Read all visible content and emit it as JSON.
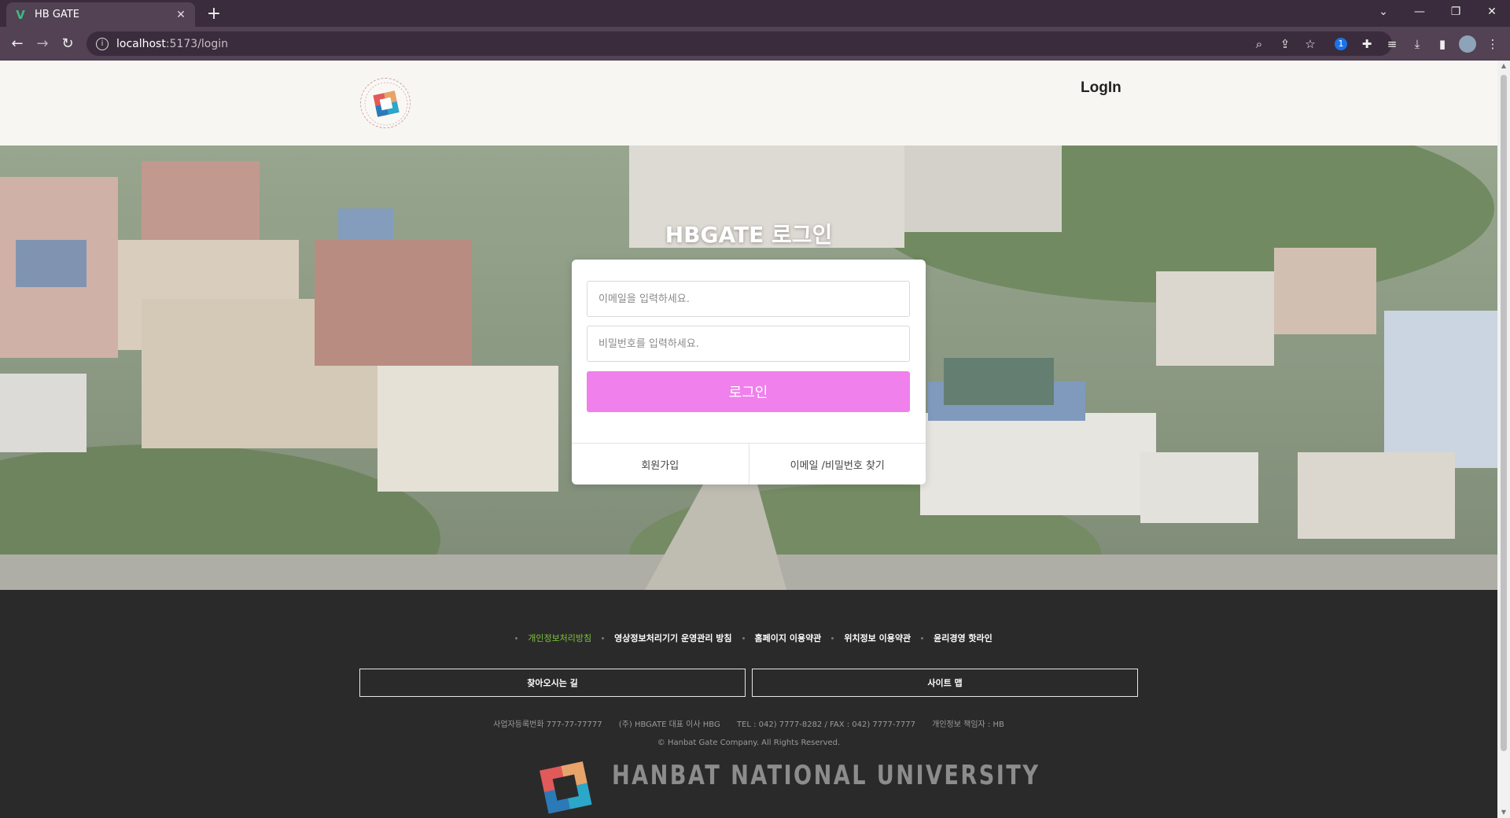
{
  "browser": {
    "tab_title": "HB GATE",
    "tab_favicon": "vue-logo-icon",
    "url_host": "localhost",
    "url_path": ":5173/login"
  },
  "header": {
    "logo_icon": "hbgate-circular-logo-icon",
    "login_link": "LogIn"
  },
  "login": {
    "title": "HBGATE 로그인",
    "email_placeholder": "이메일을 입력하세요.",
    "password_placeholder": "비밀번호를 입력하세요.",
    "submit_label": "로그인",
    "signup_label": "회원가입",
    "find_label": "이메일 /비밀번호 찾기"
  },
  "footer": {
    "links": [
      "개인정보처리방침",
      "영상정보처리기기 운영관리 방침",
      "홈페이지 이용약관",
      "위치정보 이용약관",
      "윤리경영 핫라인"
    ],
    "directions_button": "찾아오시는 길",
    "sitemap_button": "사이트 맵",
    "business_no": "사업자등록번화 777-77-77777",
    "company": "(주) HBGATE 대표 이사 HBG",
    "contact": "TEL : 042) 7777-8282 / FAX : 042) 7777-7777",
    "privacy_officer": "개인정보 책임자 : HB",
    "copyright": "© Hanbat Gate Company. All Rights Reserved.",
    "university_name": "HANBAT NATIONAL UNIVERSITY"
  },
  "colors": {
    "accent_button": "#f080ec",
    "policy_highlight": "#7dc23d",
    "footer_bg": "#2a2a2a",
    "header_bg": "#f7f6f2"
  }
}
